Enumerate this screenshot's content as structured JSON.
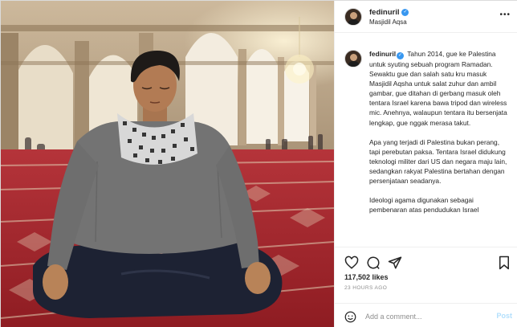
{
  "post": {
    "username": "fedinuril",
    "verified": true,
    "location": "Masjidil Aqsa",
    "caption_paragraphs": [
      "Tahun 2014, gue ke Palestina untuk syuting sebuah program Ramadan. Sewaktu gue dan salah satu kru masuk Masjidil Aqsha untuk salat zuhur dan ambil gambar, gue ditahan di gerbang masuk oleh tentara Israel karena bawa tripod dan wireless mic. Anehnya, walaupun tentara itu bersenjata lengkap, gue nggak merasa takut.",
      "Apa yang terjadi di Palestina bukan perang, tapi perebutan paksa. Tentara Israel didukung teknologi militer dari US dan negara maju lain, sedangkan rakyat Palestina bertahan dengan persenjataan seadanya.",
      "Ideologi agama digunakan sebagai pembenaran atas pendudukan Israel"
    ],
    "likes": "117,502 likes",
    "time": "23 HOURS AGO"
  },
  "comment": {
    "placeholder": "Add a comment...",
    "post_label": "Post"
  },
  "icons": [
    "more-icon",
    "heart-icon",
    "comment-icon",
    "share-icon",
    "bookmark-icon",
    "emoji-icon",
    "verified-icon"
  ],
  "colors": {
    "verified": "#3897f0",
    "border": "#efefef",
    "muted": "#8e8e8e",
    "post_button": "#b2dffc",
    "carpet": "#a8262a"
  }
}
